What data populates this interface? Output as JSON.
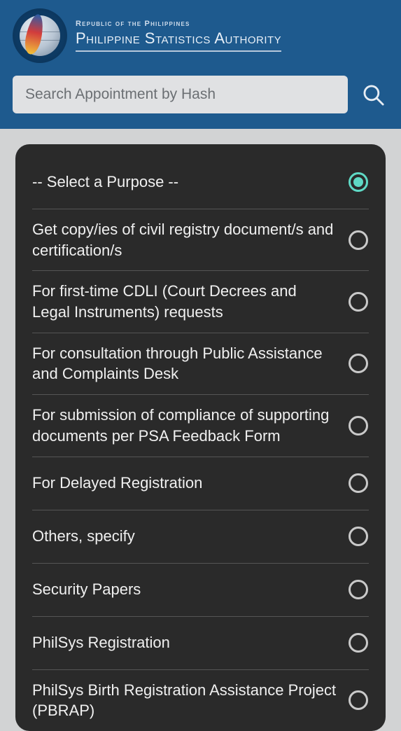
{
  "header": {
    "subtitle": "Republic of the Philippines",
    "title": "Philippine Statistics Authority"
  },
  "search": {
    "placeholder": "Search Appointment by Hash"
  },
  "purpose": {
    "options": [
      {
        "label": "-- Select a Purpose --",
        "selected": true
      },
      {
        "label": "Get copy/ies of civil registry document/s and certification/s",
        "selected": false
      },
      {
        "label": "For first-time CDLI (Court Decrees and Legal Instruments) requests",
        "selected": false
      },
      {
        "label": "For consultation through Public Assistance and Complaints Desk",
        "selected": false
      },
      {
        "label": "For submission of compliance of supporting documents per PSA Feedback Form",
        "selected": false
      },
      {
        "label": "For Delayed Registration",
        "selected": false
      },
      {
        "label": "Others, specify",
        "selected": false
      },
      {
        "label": "Security Papers",
        "selected": false
      },
      {
        "label": "PhilSys Registration",
        "selected": false
      },
      {
        "label": "PhilSys Birth Registration Assistance Project (PBRAP)",
        "selected": false
      }
    ]
  }
}
